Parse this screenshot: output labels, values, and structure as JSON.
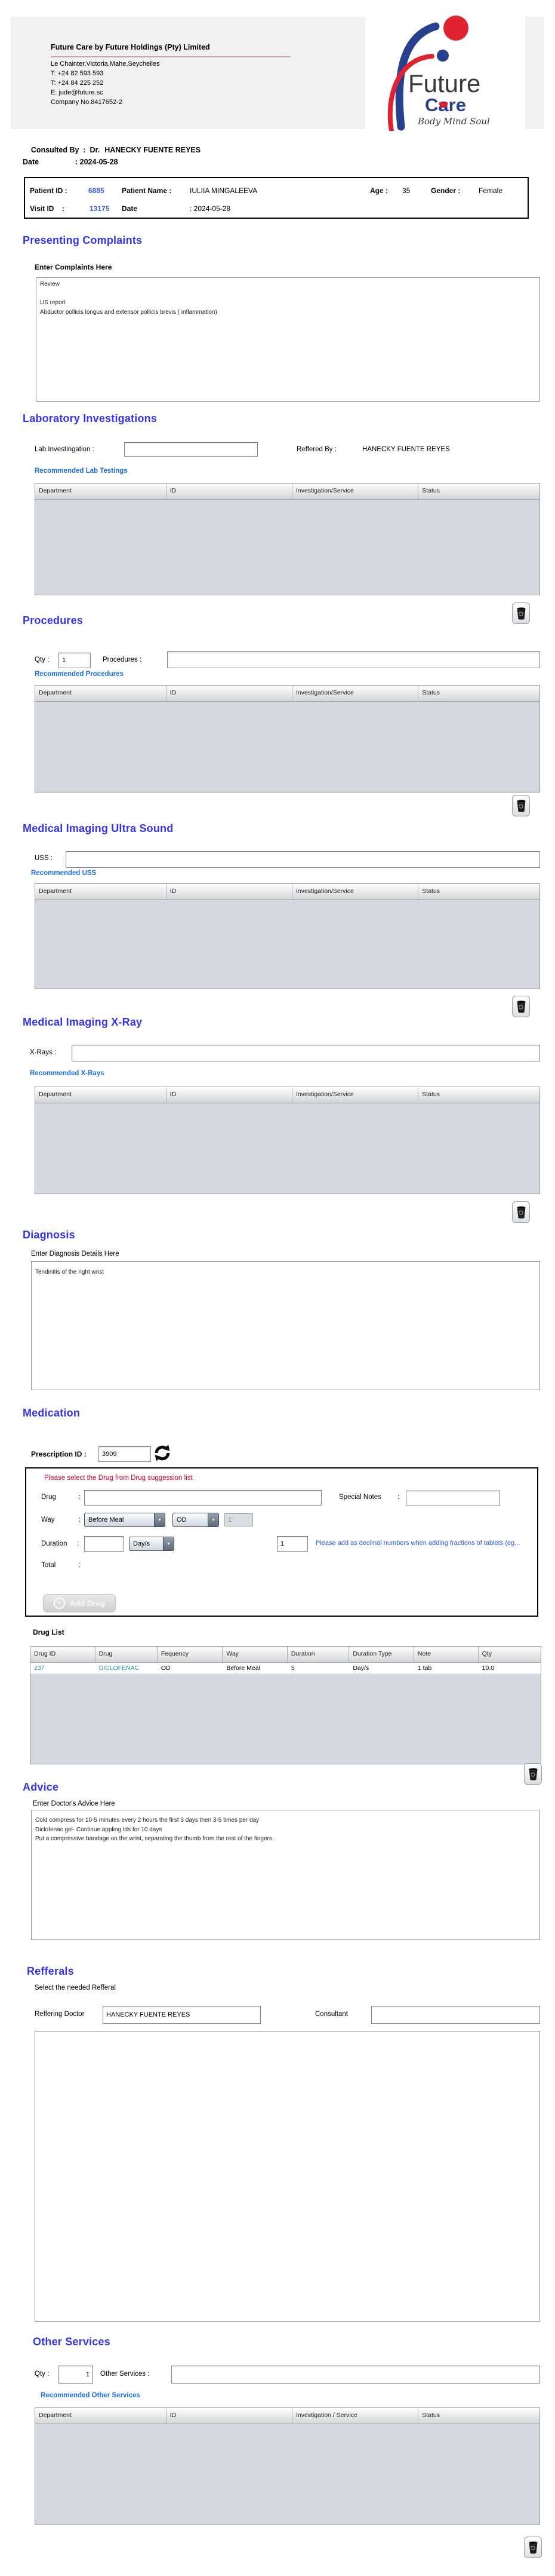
{
  "colors": {
    "heading_blue": "#3434f0",
    "link_blue": "#1b6ee8",
    "warning_red": "#cc0033",
    "drug_teal": "#2d9494",
    "id_blue": "#3b66d6",
    "logo_blue": "#27418f",
    "logo_red": "#e02330"
  },
  "ui": {
    "colon": ":",
    "dropdown_arrow": "▼",
    "plus": "+"
  },
  "letterhead": {
    "title": "Future Care by Future Holdings (Pty) Limited",
    "address": "Le Chainter,Victoria,Mahe,Seychelles",
    "phone1": "T: +24  82 593 593",
    "phone2": "T: +24  84 225 252",
    "email": "E: jude@future.sc",
    "company_no": "Company No.8417652-2",
    "logo": {
      "future": "Future",
      "care": "Care",
      "tagline": "Body Mind Soul"
    }
  },
  "consulted": {
    "label": "Consulted By  :  Dr.",
    "value": "HANECKY FUENTE REYES"
  },
  "visit_date": {
    "label": "Date",
    "value": ": 2024-05-28"
  },
  "patient": {
    "id_label": "Patient ID :",
    "id": "6885",
    "name_label": "Patient Name :",
    "name": "IULIIA MINGALEEVA",
    "age_label": "Age :",
    "age": "35",
    "gender_label": "Gender :",
    "gender": "Female",
    "visit_label": "Visit ID    :",
    "visit_id": "13175",
    "date_label": "Date",
    "date_value": ": 2024-05-28"
  },
  "presenting": {
    "heading": "Presenting Complaints",
    "sub": "Enter Complaints Here",
    "text": "Review\n\nUS report\nAbductor pollicis longus and extensor pollicis brevis ( inflammation)"
  },
  "lab": {
    "heading": "Laboratory  Investigations",
    "input_label": "Lab Investingation :",
    "input_value": "",
    "referred_label": "Reffered By :",
    "referred_value": "HANECKY FUENTE REYES",
    "link": "Recommended Lab Testings",
    "headers": [
      "Department",
      "ID",
      "Investigation/Service",
      "Status"
    ]
  },
  "procedures": {
    "heading": "Procedures",
    "qty_label": "Qty :",
    "qty": "1",
    "input_label": "Procedures :",
    "input_value": "",
    "link": "Recommended Procedures",
    "headers": [
      "Department",
      "ID",
      "Investigation/Service",
      "Status"
    ]
  },
  "uss": {
    "heading": "Medical Imaging Ultra Sound",
    "input_label": "USS :",
    "input_value": "",
    "link": "Recommended USS",
    "headers": [
      "Department",
      "ID",
      "Investigation/Service",
      "Status"
    ]
  },
  "xray": {
    "heading": "Medical Imaging X-Ray",
    "input_label": "X-Rays :",
    "input_value": "",
    "link": "Recommended X-Rays",
    "headers": [
      "Department",
      "ID",
      "Investigation/Service",
      "Status"
    ]
  },
  "diagnosis": {
    "heading": "Diagnosis",
    "sub": "Enter Diagnosis Details Here",
    "text": "Tendinitis of the right wrist"
  },
  "medication": {
    "heading": "Medication",
    "prescription_label": "Prescription ID :",
    "prescription_id": "3909",
    "warning": "Please select the Drug from Drug suggession list",
    "drug_label": "Drug",
    "drug_value": "",
    "special_label": "Special Notes",
    "special_value": "",
    "way_label": "Way",
    "way_value": "Before Meal",
    "frequency_value": "OD",
    "dose_value": "1",
    "duration_label": "Duration",
    "duration_value": "",
    "duration_type_value": "Day/s",
    "tablet_qty": "1",
    "hint": "Please add as decimal numbers when adding fractions of tablets (eg...",
    "total_label": "Total",
    "add_button": "Add Drug",
    "list_label": "Drug List",
    "headers": [
      "Drug ID",
      "Drug",
      "Fequency",
      "Way",
      "Duration",
      "Duration Type",
      "Note",
      "Qty"
    ],
    "rows": [
      [
        "237",
        "DICLOFENAC",
        "OD",
        "Before Meal",
        "5",
        "Day/s",
        "1 tab",
        "10.0"
      ]
    ]
  },
  "advice": {
    "heading": "Advice",
    "sub": "Enter Doctor's Advice Here",
    "text": "Cold compress for 10-5 minutes every 2 hours the first 3 days then 3-5 times per day\nDiclofenac gel- Continue appling tds for 10 days\nPut a compressive bandage on the wrist, separating the thumb from the rest of the fingers."
  },
  "referrals": {
    "heading": "Refferals",
    "sub": "Select the needed Refferal",
    "doctor_label": "Reffering Doctor",
    "doctor_value": "HANECKY FUENTE REYES",
    "consultant_label": "Consultant",
    "consultant_value": ""
  },
  "other": {
    "heading": "Other Services",
    "qty_label": "Qty :",
    "qty": "1",
    "input_label": "Other Services :",
    "input_value": "",
    "link": "Recommended Other Services",
    "headers": [
      "Department",
      "ID",
      "Investigation / Service",
      "Status"
    ]
  }
}
